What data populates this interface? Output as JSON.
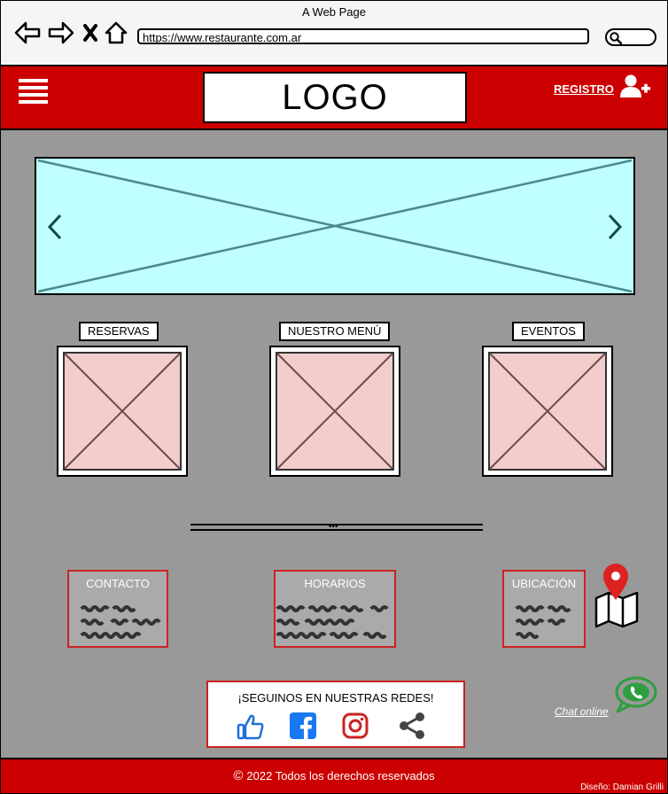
{
  "browser": {
    "title": "A Web Page",
    "url": "https://www.restaurante.com.ar"
  },
  "header": {
    "logo_text": "LOGO",
    "register_label": "REGISTRO"
  },
  "cards": [
    {
      "label": "RESERVAS"
    },
    {
      "label": "NUESTRO MENÚ"
    },
    {
      "label": "EVENTOS"
    }
  ],
  "info": [
    {
      "title": "CONTACTO"
    },
    {
      "title": "HORARIOS"
    },
    {
      "title": "UBICACIÓN"
    }
  ],
  "social": {
    "title": "¡SEGUINOS EN NUESTRAS REDES!",
    "icons": [
      "thumbs-up-icon",
      "facebook-icon",
      "instagram-icon",
      "share-icon"
    ]
  },
  "chat": {
    "label": "Chat online"
  },
  "footer": {
    "copyright": "2022 Todos los derechos reservados",
    "credit": "Diseño: Damian Grilli"
  },
  "colors": {
    "brand_red": "#cc0000",
    "page_bg": "#999999",
    "carousel_bg": "#bfffff",
    "placeholder_pink": "#f3cccc",
    "facebook_blue": "#1877f2",
    "instagram_red": "#cc2222",
    "whatsapp_green": "#2e9e3e"
  }
}
